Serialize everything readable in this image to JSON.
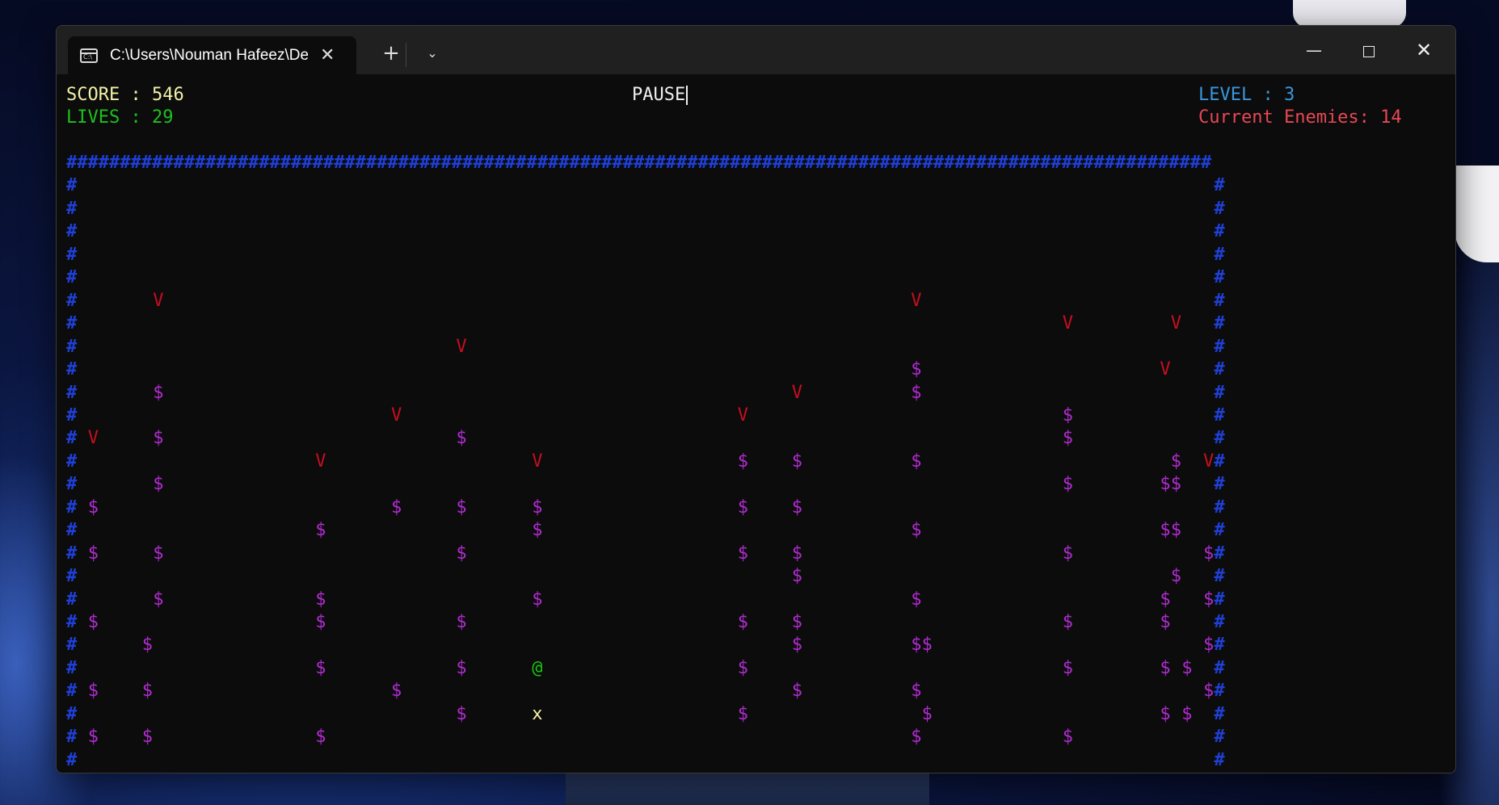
{
  "window": {
    "tab_title": "C:\\Users\\Nouman Hafeez\\Des",
    "tab_icon": "command-prompt-icon",
    "icon_text": "C:\\",
    "close_tab_glyph": "✕",
    "new_tab_glyph": "+",
    "dropdown_glyph": "⌄",
    "minimize_glyph": "—",
    "close_glyph": "✕"
  },
  "hud": {
    "score": "SCORE : 546",
    "lives": "LIVES : 29",
    "status": "PAUSE",
    "level": "LEVEL : 3",
    "enemies": "Current Enemies: 14"
  },
  "game": {
    "wall_char": "#",
    "enemy_char": "V",
    "coin_char": "$",
    "player_char": "@",
    "bullet_char": "x",
    "enemies": [
      [
        8,
        6
      ],
      [
        78,
        6
      ],
      [
        92,
        7
      ],
      [
        102,
        7
      ],
      [
        36,
        8
      ],
      [
        101,
        9
      ],
      [
        67,
        10
      ],
      [
        30,
        11
      ],
      [
        62,
        11
      ],
      [
        2,
        12
      ],
      [
        23,
        13
      ],
      [
        43,
        13
      ],
      [
        105,
        13
      ]
    ],
    "coins": [
      [
        78,
        9
      ],
      [
        8,
        10
      ],
      [
        78,
        10
      ],
      [
        92,
        11
      ],
      [
        8,
        12
      ],
      [
        36,
        12
      ],
      [
        92,
        12
      ],
      [
        62,
        13
      ],
      [
        67,
        13
      ],
      [
        78,
        13
      ],
      [
        102,
        13
      ],
      [
        8,
        14
      ],
      [
        92,
        14
      ],
      [
        101,
        14
      ],
      [
        102,
        14
      ],
      [
        2,
        15
      ],
      [
        30,
        15
      ],
      [
        36,
        15
      ],
      [
        43,
        15
      ],
      [
        62,
        15
      ],
      [
        67,
        15
      ],
      [
        23,
        16
      ],
      [
        43,
        16
      ],
      [
        78,
        16
      ],
      [
        101,
        16
      ],
      [
        102,
        16
      ],
      [
        2,
        17
      ],
      [
        8,
        17
      ],
      [
        36,
        17
      ],
      [
        62,
        17
      ],
      [
        67,
        17
      ],
      [
        92,
        17
      ],
      [
        105,
        17
      ],
      [
        67,
        18
      ],
      [
        102,
        18
      ],
      [
        8,
        19
      ],
      [
        23,
        19
      ],
      [
        43,
        19
      ],
      [
        78,
        19
      ],
      [
        101,
        19
      ],
      [
        105,
        19
      ],
      [
        2,
        20
      ],
      [
        23,
        20
      ],
      [
        36,
        20
      ],
      [
        62,
        20
      ],
      [
        67,
        20
      ],
      [
        92,
        20
      ],
      [
        101,
        20
      ],
      [
        7,
        21
      ],
      [
        67,
        21
      ],
      [
        78,
        21
      ],
      [
        79,
        21
      ],
      [
        105,
        21
      ],
      [
        23,
        22
      ],
      [
        36,
        22
      ],
      [
        62,
        22
      ],
      [
        92,
        22
      ],
      [
        101,
        22
      ],
      [
        103,
        22
      ],
      [
        2,
        23
      ],
      [
        7,
        23
      ],
      [
        30,
        23
      ],
      [
        67,
        23
      ],
      [
        78,
        23
      ],
      [
        105,
        23
      ],
      [
        36,
        24
      ],
      [
        62,
        24
      ],
      [
        79,
        24
      ],
      [
        101,
        24
      ],
      [
        103,
        24
      ],
      [
        2,
        25
      ],
      [
        7,
        25
      ],
      [
        23,
        25
      ],
      [
        78,
        25
      ],
      [
        92,
        25
      ]
    ],
    "player": [
      43,
      22
    ],
    "bullet": [
      43,
      24
    ],
    "colors": {
      "wall": "#1f40d8",
      "enemy": "#c50f1f",
      "coin": "#b02bd0",
      "player": "#16c60c",
      "bullet": "#f9f1a5",
      "score": "#f2f2a8",
      "lives": "#1fc01f",
      "level": "#3a96dd",
      "enemies_counter": "#e74856"
    }
  }
}
